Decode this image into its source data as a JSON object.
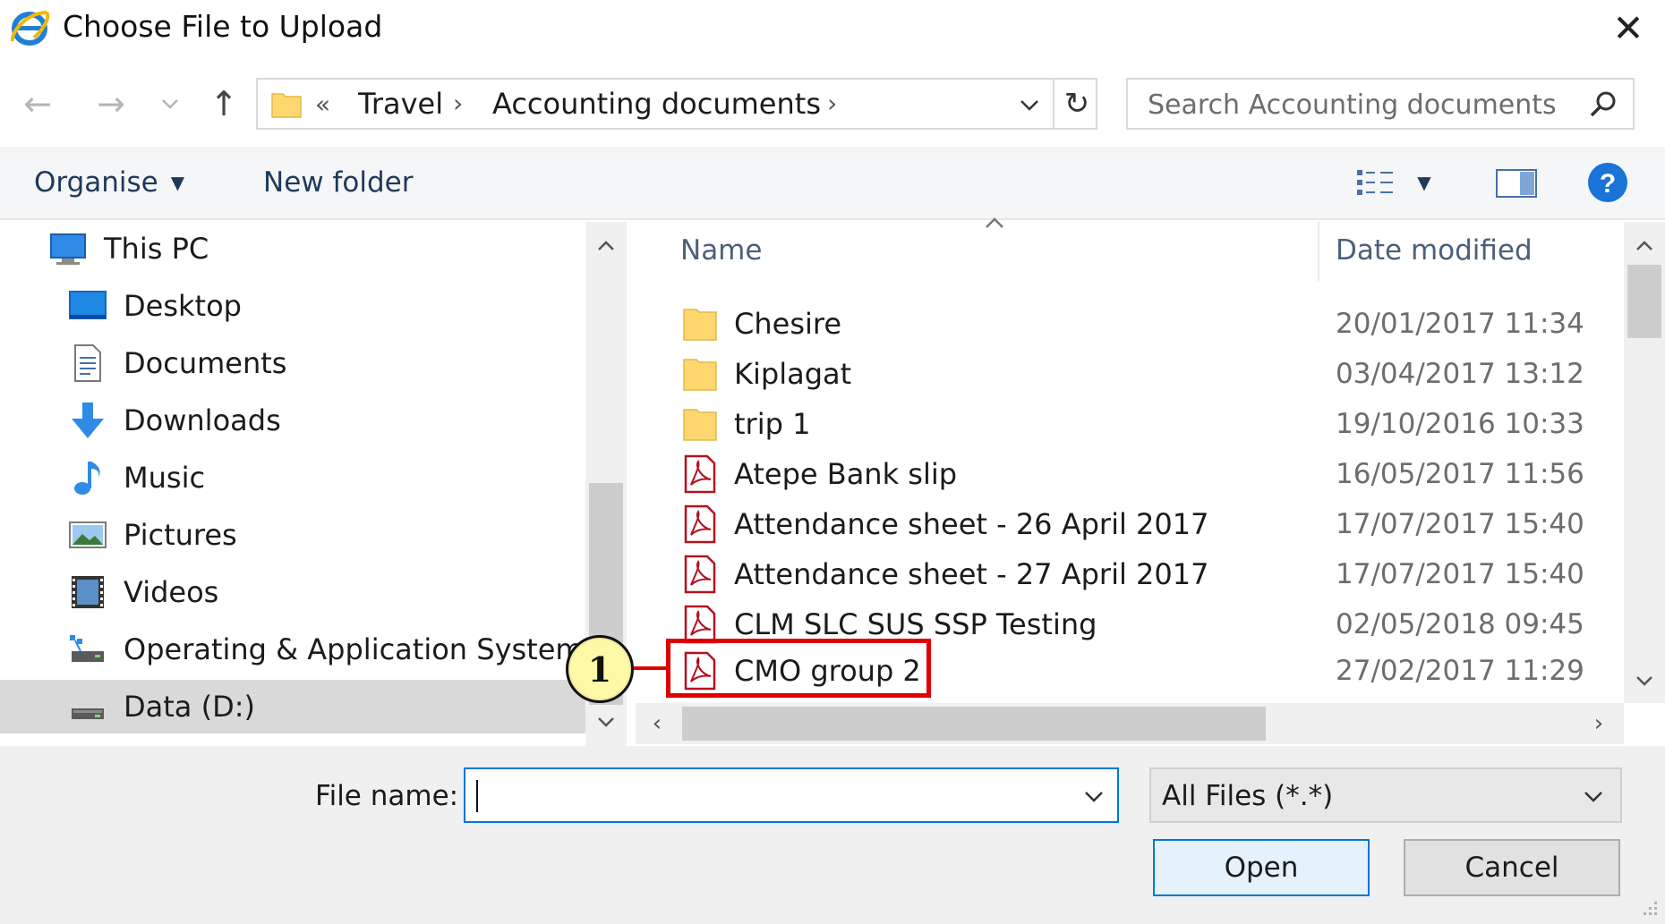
{
  "window": {
    "title": "Choose File to Upload",
    "close_glyph": "✕",
    "app_icon": "internet-explorer-icon"
  },
  "navigation": {
    "back_glyph": "←",
    "forward_glyph": "→",
    "recent_glyph": "⌄",
    "up_glyph": "↑"
  },
  "address": {
    "overflow": "«",
    "crumbs": [
      "Travel",
      "Accounting documents"
    ],
    "separator": "›",
    "refresh_glyph": "↻"
  },
  "search": {
    "placeholder": "Search Accounting documents"
  },
  "toolbar": {
    "organise_label": "Organise",
    "dropdown_glyph": "▼",
    "new_folder_label": "New folder"
  },
  "nav_pane": {
    "items": [
      {
        "label": "This PC",
        "icon": "this-pc-icon"
      },
      {
        "label": "Desktop",
        "icon": "desktop-icon"
      },
      {
        "label": "Documents",
        "icon": "documents-icon"
      },
      {
        "label": "Downloads",
        "icon": "downloads-icon"
      },
      {
        "label": "Music",
        "icon": "music-icon"
      },
      {
        "label": "Pictures",
        "icon": "pictures-icon"
      },
      {
        "label": "Videos",
        "icon": "videos-icon"
      },
      {
        "label": "Operating & Application Systems",
        "icon": "network-drive-icon"
      },
      {
        "label": "Data (D:)",
        "icon": "drive-icon",
        "selected": true
      }
    ]
  },
  "file_list": {
    "columns": {
      "name": "Name",
      "date": "Date modified"
    },
    "sort_glyph": "^",
    "rows": [
      {
        "name": "Chesire",
        "date": "20/01/2017 11:34",
        "type": "folder"
      },
      {
        "name": "Kiplagat",
        "date": "03/04/2017 13:12",
        "type": "folder"
      },
      {
        "name": "trip 1",
        "date": "19/10/2016 10:33",
        "type": "folder"
      },
      {
        "name": "Atepe Bank slip",
        "date": "16/05/2017 11:56",
        "type": "pdf"
      },
      {
        "name": "Attendance sheet - 26 April 2017",
        "date": "17/07/2017 15:40",
        "type": "pdf"
      },
      {
        "name": "Attendance sheet - 27 April 2017",
        "date": "17/07/2017 15:40",
        "type": "pdf"
      },
      {
        "name": "CLM SLC SUS SSP  Testing",
        "date": "02/05/2018 09:45",
        "type": "pdf"
      },
      {
        "name": "CMO group 2",
        "date": "27/02/2017 11:29",
        "type": "pdf"
      }
    ]
  },
  "scroll": {
    "up": "^",
    "down": "⌄",
    "left": "‹",
    "right": "›"
  },
  "bottom": {
    "file_name_label": "File name:",
    "file_name_value": "",
    "file_type_value": "All Files (*.*)",
    "open_label": "Open",
    "cancel_label": "Cancel"
  },
  "annotation": {
    "step_number": "1",
    "highlight_color": "#e00000",
    "badge_color": "#fef9a6"
  },
  "colors": {
    "accent": "#0078d7",
    "toolbar_text": "#1e395b",
    "folder": "#ffd76e",
    "pdf_red": "#b3121f"
  }
}
